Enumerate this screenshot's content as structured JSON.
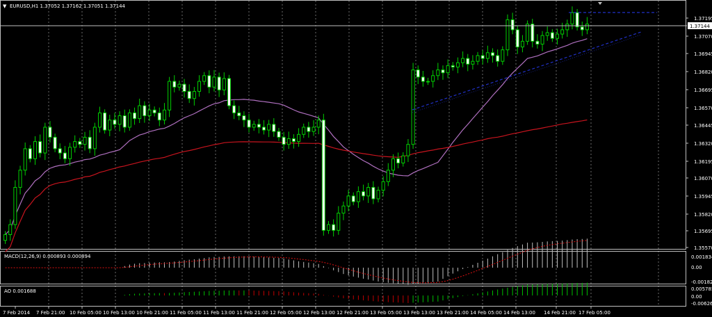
{
  "header": {
    "menu_glyph": "▼",
    "label": "EURUSD,H1  1.37052 1.37162 1.37051 1.37144"
  },
  "colors": {
    "background": "#000000",
    "candle": "#00d000",
    "grid": "#ffffff",
    "frame": "#c0c0c0",
    "ma_fast": "#b070c0",
    "ma_slow": "#c8141e",
    "trend": "#2030c8",
    "macd_hist": "#c0c0c0",
    "macd_signal": "#e01010",
    "ao_up": "#00c000",
    "ao_down": "#c00000"
  },
  "chart_data": [
    {
      "type": "candlestick",
      "symbol": "EURUSD",
      "timeframe": "H1",
      "ohlc_last": {
        "open": 1.37052,
        "high": 1.37162,
        "low": 1.37051,
        "close": 1.37144
      },
      "current_price": "1.37144",
      "ylim": [
        1.3557,
        1.3722
      ],
      "y_ticks": [
        "1.37195",
        "1.37070",
        "1.36945",
        "1.36820",
        "1.36695",
        "1.36570",
        "1.36445",
        "1.36320",
        "1.36195",
        "1.36070",
        "1.35945",
        "1.35820",
        "1.35695",
        "1.35570"
      ],
      "x_ticks": [
        "7 Feb 2014",
        "7 Feb 21:00",
        "10 Feb 05:00",
        "10 Feb 13:00",
        "10 Feb 21:00",
        "11 Feb 05:00",
        "11 Feb 13:00",
        "11 Feb 21:00",
        "12 Feb 05:00",
        "12 Feb 13:00",
        "12 Feb 21:00",
        "13 Feb 05:00",
        "13 Feb 13:00",
        "13 Feb 21:00",
        "14 Feb 05:00",
        "14 Feb 13:00",
        "14 Feb 21:00",
        "17 Feb 05:00"
      ],
      "closes": [
        1.3565,
        1.3572,
        1.3598,
        1.361,
        1.3625,
        1.3618,
        1.363,
        1.3622,
        1.364,
        1.3633,
        1.3625,
        1.3622,
        1.3618,
        1.3626,
        1.363,
        1.3628,
        1.3633,
        1.3625,
        1.364,
        1.365,
        1.3638,
        1.3645,
        1.3642,
        1.3648,
        1.364,
        1.365,
        1.3646,
        1.3655,
        1.3648,
        1.3652,
        1.365,
        1.3645,
        1.3652,
        1.3672,
        1.3668,
        1.367,
        1.3665,
        1.366,
        1.3665,
        1.3672,
        1.3676,
        1.3668,
        1.3675,
        1.3666,
        1.3674,
        1.3655,
        1.365,
        1.3648,
        1.3645,
        1.364,
        1.3642,
        1.364,
        1.3638,
        1.3642,
        1.3637,
        1.3633,
        1.3628,
        1.3632,
        1.363,
        1.3635,
        1.364,
        1.3637,
        1.364,
        1.3645,
        1.3568,
        1.3572,
        1.3568,
        1.358,
        1.3585,
        1.3592,
        1.3588,
        1.3595,
        1.3592,
        1.3598,
        1.359,
        1.3596,
        1.3602,
        1.361,
        1.3618,
        1.3615,
        1.362,
        1.3628,
        1.368,
        1.3675,
        1.3672,
        1.3672,
        1.3676,
        1.368,
        1.3678,
        1.3683,
        1.3682,
        1.3685,
        1.3688,
        1.3684,
        1.3686,
        1.369,
        1.3688,
        1.3692,
        1.369,
        1.3686,
        1.3694,
        1.3715,
        1.3708,
        1.3696,
        1.37,
        1.3712,
        1.37,
        1.3698,
        1.3704,
        1.3706,
        1.3702,
        1.3705,
        1.3708,
        1.3712,
        1.372,
        1.371,
        1.3708,
        1.3712
      ]
    },
    {
      "type": "line",
      "name": "MACD(12,26,9) 0.000893 0.000894",
      "label": "MACD(12,26,9) 0.000893 0.000894",
      "y_ticks": [
        "0.001834",
        "0.00",
        "-0.00182"
      ],
      "ylim": [
        -0.00182,
        0.001834
      ]
    },
    {
      "type": "bar",
      "name": "AO 0.001688",
      "label": "AO 0.001688",
      "y_ticks": [
        "0.005785",
        "0.00",
        "-0.00626"
      ],
      "ylim": [
        -0.00626,
        0.005785
      ]
    }
  ]
}
